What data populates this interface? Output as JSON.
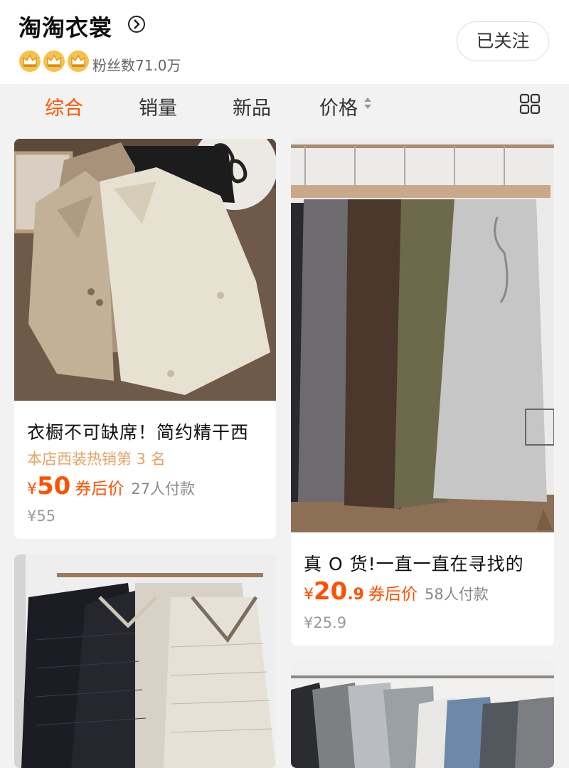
{
  "shop": {
    "name": "淘淘衣裳",
    "fans": "粉丝数71.0万",
    "follow_label": "已关注"
  },
  "tabs": [
    {
      "label": "综合",
      "active": true
    },
    {
      "label": "销量",
      "active": false
    },
    {
      "label": "新品",
      "active": false
    },
    {
      "label": "价格",
      "active": false
    }
  ],
  "products": [
    {
      "title": "衣橱不可缺席！简约精干西",
      "rank": "本店西装热销第 3 名",
      "price_symbol": "¥",
      "price_int": "50",
      "price_frac": "",
      "coupon": "券后价",
      "paid": "27人付款",
      "original_price": "¥55",
      "image": "blazers-image"
    },
    {
      "title": "真 O 货!一直一直在寻找的",
      "price_symbol": "¥",
      "price_int": "20",
      "price_frac": ".9",
      "coupon": "券后价",
      "paid": "58人付款",
      "original_price": "¥25.9",
      "image": "pants-image"
    },
    {
      "image": "tweed-jackets-image"
    },
    {
      "image": "coats-rack-image"
    }
  ],
  "colors": {
    "accent": "#ff5500",
    "price": "#ff5000",
    "rank": "#e3a466"
  }
}
